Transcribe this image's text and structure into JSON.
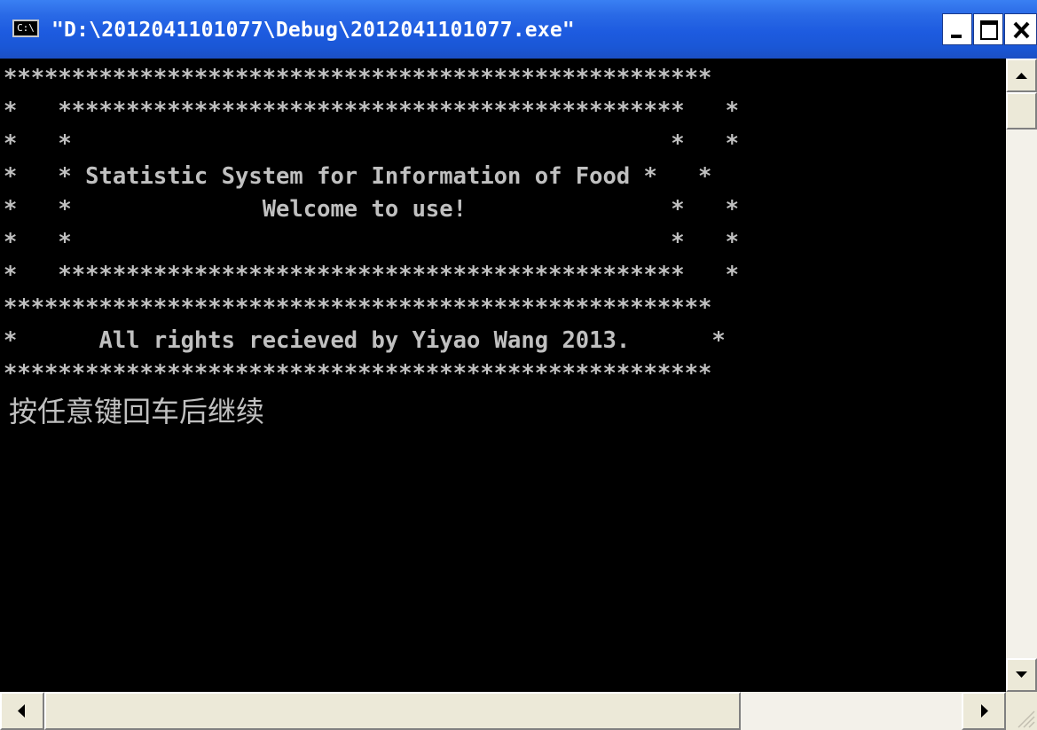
{
  "window": {
    "icon_text": "C:\\",
    "title": "\"D:\\2012041101077\\Debug\\2012041101077.exe\""
  },
  "titlebar_buttons": {
    "minimize": "minimize",
    "maximize": "maximize",
    "close": "close"
  },
  "console": {
    "lines": [
      "****************************************************",
      "*   **********************************************   *",
      "*   *                                            *   *",
      "*   * Statistic System for Information of Food *   *",
      "*   *              Welcome to use!               *   *",
      "*   *                                            *   *",
      "*   **********************************************   *",
      "****************************************************",
      "*      All rights recieved by Yiyao Wang 2013.      *",
      "****************************************************"
    ],
    "prompt": "按任意键回车后继续"
  },
  "icons": {
    "app": "console-app-icon",
    "minimize": "minimize-icon",
    "maximize": "maximize-icon",
    "close": "close-icon",
    "scroll_up": "arrow-up-icon",
    "scroll_down": "arrow-down-icon",
    "scroll_left": "arrow-left-icon",
    "scroll_right": "arrow-right-icon"
  },
  "colors": {
    "titlebar": "#1d5be0",
    "console_bg": "#000000",
    "console_text": "#c0c0c0"
  }
}
